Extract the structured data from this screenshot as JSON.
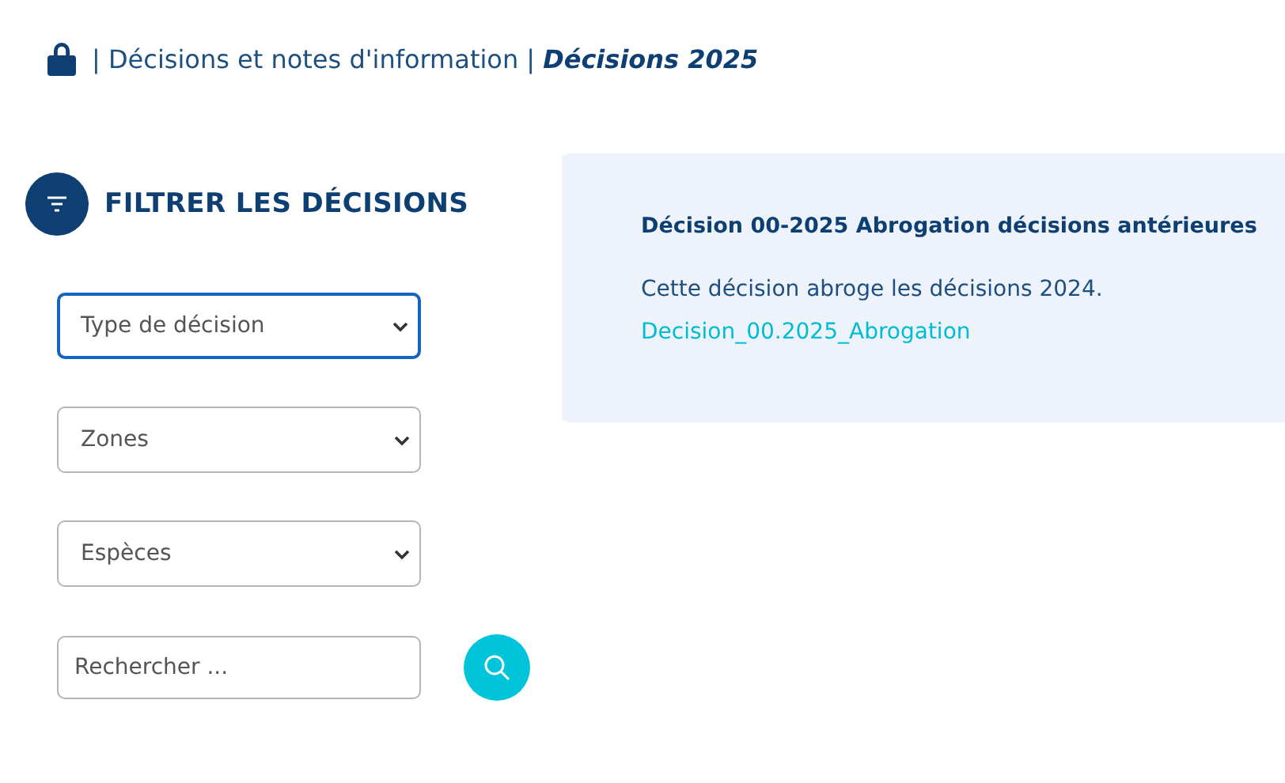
{
  "breadcrumb": {
    "path": "| Décisions et notes d'information |",
    "current": "Décisions 2025"
  },
  "filter": {
    "title": "FILTRER LES DÉCISIONS",
    "selects": [
      {
        "label": "Type de décision",
        "focused": true
      },
      {
        "label": "Zones",
        "focused": false
      },
      {
        "label": "Espèces",
        "focused": false
      }
    ],
    "search": {
      "placeholder": "Rechercher ..."
    }
  },
  "results": [
    {
      "title": "Décision 00-2025 Abrogation décisions antérieures",
      "description": "Cette décision abroge les décisions 2024.",
      "link": "Decision_00.2025_Abrogation"
    }
  ]
}
